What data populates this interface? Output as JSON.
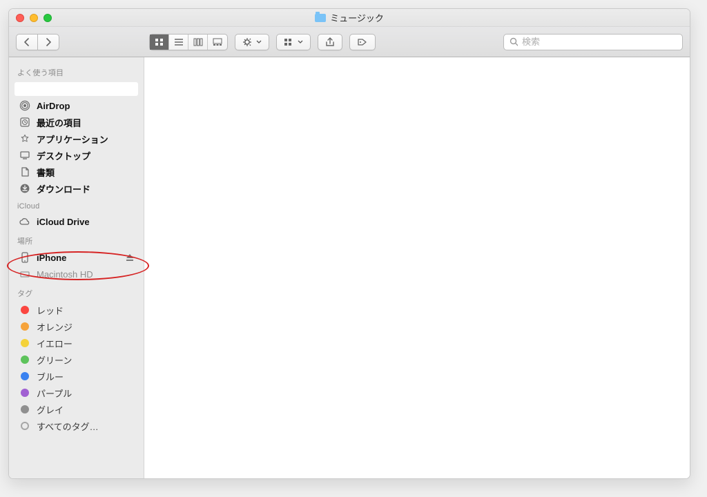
{
  "window": {
    "title": "ミュージック"
  },
  "search": {
    "placeholder": "検索"
  },
  "sidebar": {
    "favorites_header": "よく使う項目",
    "favorites": [
      {
        "label": ""
      },
      {
        "label": "AirDrop"
      },
      {
        "label": "最近の項目"
      },
      {
        "label": "アプリケーション"
      },
      {
        "label": "デスクトップ"
      },
      {
        "label": "書類"
      },
      {
        "label": "ダウンロード"
      }
    ],
    "icloud_header": "iCloud",
    "icloud": [
      {
        "label": "iCloud Drive"
      }
    ],
    "locations_header": "場所",
    "locations": [
      {
        "label": "iPhone"
      },
      {
        "label": "Macintosh HD"
      }
    ],
    "tags_header": "タグ",
    "tags": [
      {
        "label": "レッド",
        "color": "#fb4640"
      },
      {
        "label": "オレンジ",
        "color": "#f6a33b"
      },
      {
        "label": "イエロー",
        "color": "#f4d23a"
      },
      {
        "label": "グリーン",
        "color": "#5dc35b"
      },
      {
        "label": "ブルー",
        "color": "#3a82f0"
      },
      {
        "label": "パープル",
        "color": "#a060d2"
      },
      {
        "label": "グレイ",
        "color": "#8f8f8f"
      }
    ],
    "all_tags_label": "すべてのタグ…"
  }
}
